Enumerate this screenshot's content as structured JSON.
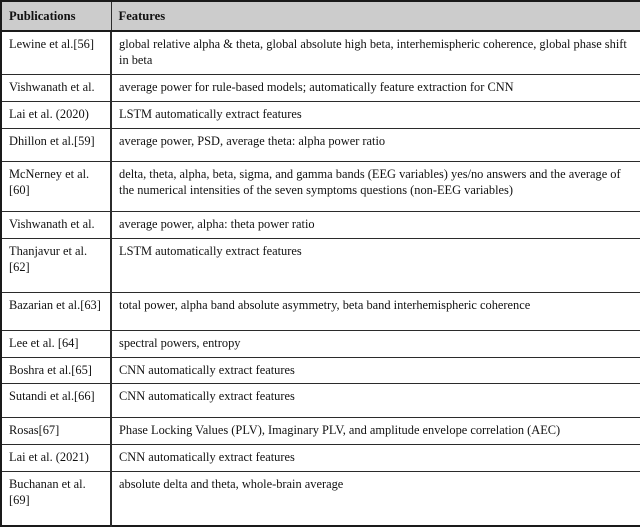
{
  "table": {
    "columns": [
      {
        "key": "publications",
        "label": "Publications"
      },
      {
        "key": "features",
        "label": "Features"
      }
    ],
    "header_background": "#cccccc",
    "border_color": "#2b2b2b",
    "rows": [
      {
        "publication": "Lewine et al.[56]",
        "features": "global relative alpha & theta, global absolute high beta, interhemispheric coherence, global phase shift in beta"
      },
      {
        "publication": "Vishwanath et al.",
        "features": "average power for rule-based models; automatically feature extraction for CNN"
      },
      {
        "publication": "Lai et al. (2020)",
        "features": "LSTM automatically extract features"
      },
      {
        "publication": "Dhillon et al.[59]",
        "features": "average power, PSD, average theta: alpha power ratio"
      },
      {
        "publication": "McNerney et al.[60]",
        "features": "delta, theta, alpha, beta, sigma, and gamma bands (EEG variables) yes/no answers and the average of the numerical intensities of the seven symptoms questions (non-EEG variables)"
      },
      {
        "publication": "Vishwanath et al.",
        "features": "average power, alpha: theta power ratio"
      },
      {
        "publication": "Thanjavur et al.[62]",
        "features": "LSTM automatically extract features"
      },
      {
        "publication": "Bazarian et al.[63]",
        "features": "total power, alpha band absolute asymmetry, beta band interhemispheric coherence"
      },
      {
        "publication": "Lee et al. [64]",
        "features": "spectral powers, entropy"
      },
      {
        "publication": "Boshra et al.[65]",
        "features": "CNN automatically extract features"
      },
      {
        "publication": "Sutandi et al.[66]",
        "features": "CNN automatically extract features"
      },
      {
        "publication": "Rosas[67]",
        "features": "Phase Locking Values (PLV), Imaginary PLV, and amplitude envelope correlation (AEC)"
      },
      {
        "publication": "Lai et al. (2021)",
        "features": "CNN automatically extract features"
      },
      {
        "publication": "Buchanan et al.[69]",
        "features": "absolute delta and theta, whole-brain average"
      }
    ]
  }
}
